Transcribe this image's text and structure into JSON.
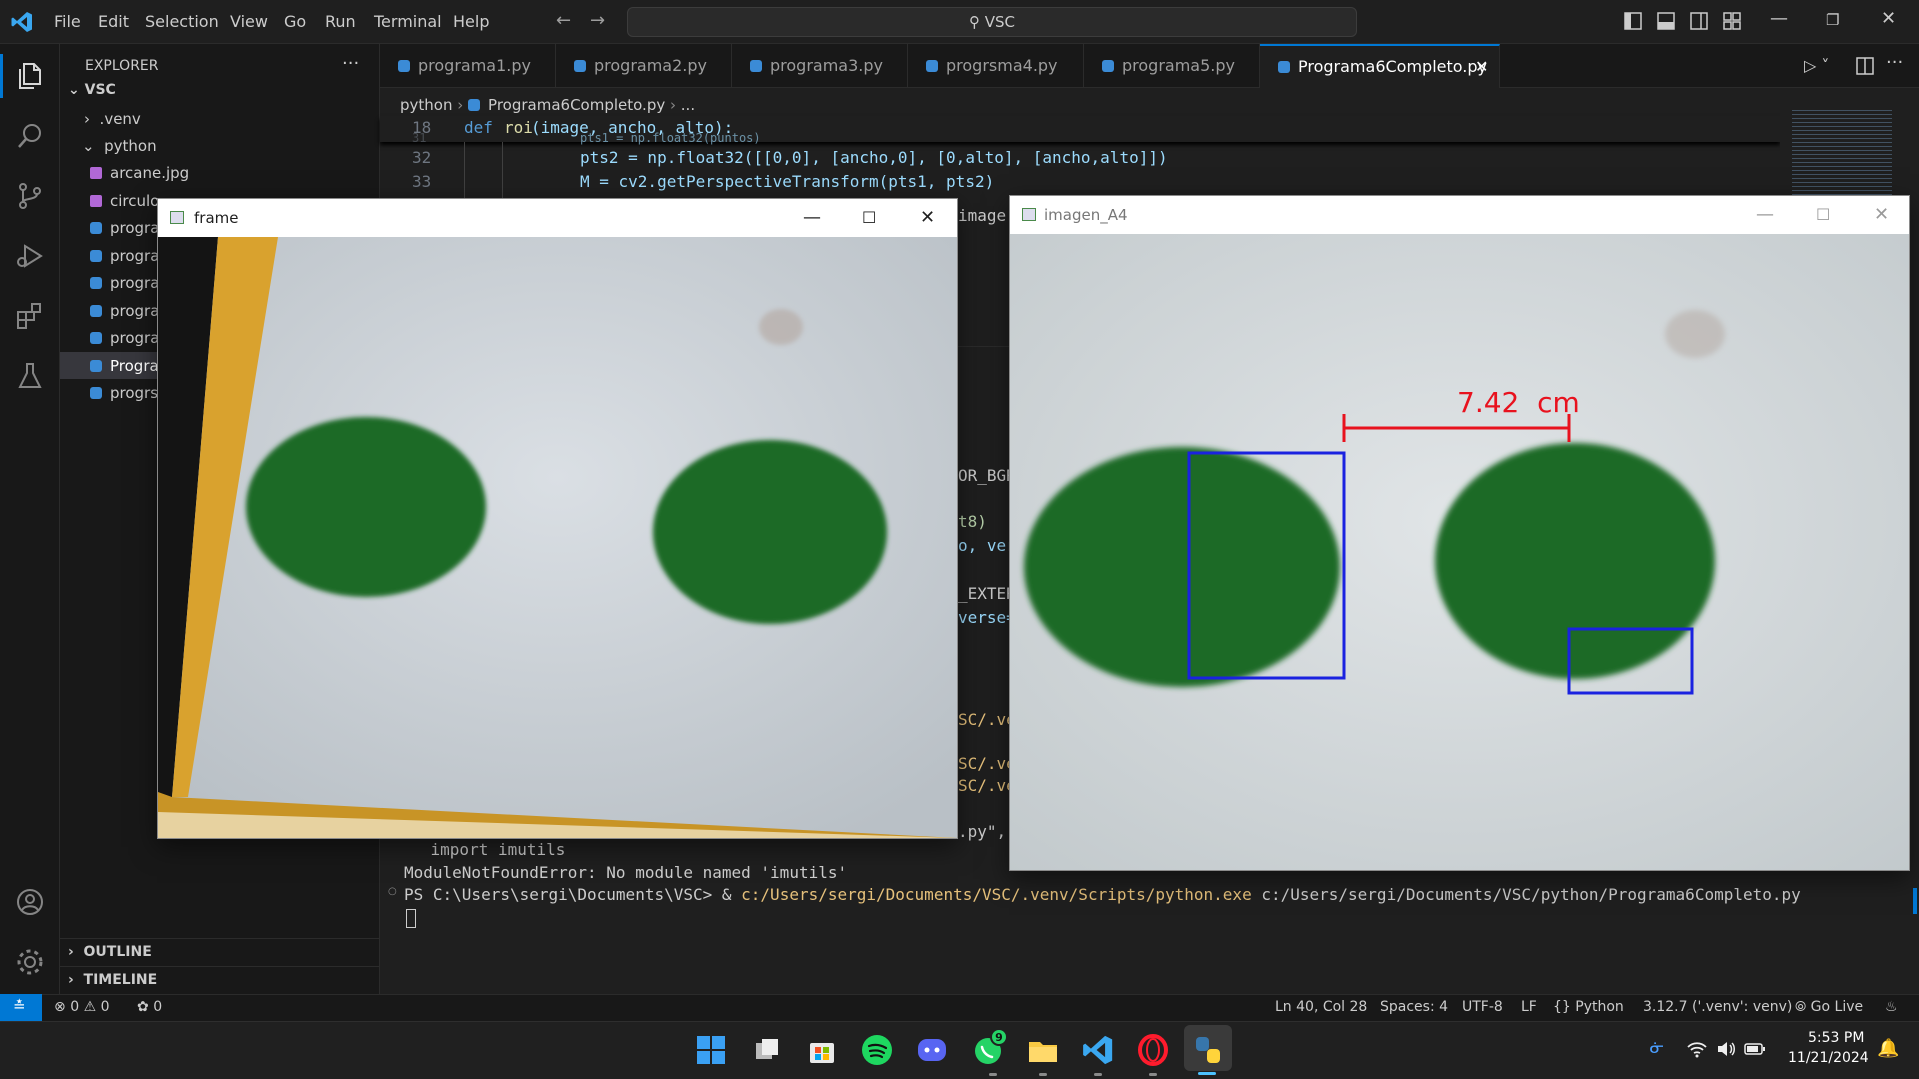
{
  "titlebar": {
    "menu": [
      "File",
      "Edit",
      "Selection",
      "View",
      "Go",
      "Run",
      "Terminal",
      "Help"
    ],
    "search": "VSC"
  },
  "sidebar": {
    "header": "EXPLORER",
    "more": "···",
    "root": "VSC",
    "items": [
      {
        "label": ".venv",
        "type": "folder"
      },
      {
        "label": "python",
        "type": "folder-open"
      },
      {
        "label": "arcane.jpg",
        "type": "image"
      },
      {
        "label": "circulo",
        "type": "image"
      },
      {
        "label": "progra",
        "type": "py"
      },
      {
        "label": "progra",
        "type": "py"
      },
      {
        "label": "progra",
        "type": "py"
      },
      {
        "label": "progra",
        "type": "py"
      },
      {
        "label": "progra",
        "type": "py"
      },
      {
        "label": "Progra",
        "type": "py"
      },
      {
        "label": "progrs",
        "type": "py"
      }
    ],
    "outline": "OUTLINE",
    "timeline": "TIMELINE"
  },
  "tabs": [
    {
      "label": "programa1.py"
    },
    {
      "label": "programa2.py"
    },
    {
      "label": "programa3.py"
    },
    {
      "label": "progrsma4.py"
    },
    {
      "label": "programa5.py"
    },
    {
      "label": "Programa6Completo.py",
      "active": true
    }
  ],
  "breadcrumb": {
    "folder": "python",
    "file": "Programa6Completo.py",
    "more": "..."
  },
  "code": {
    "sticky": {
      "line": "18",
      "kw": "def",
      "fn": "roi",
      "args": "(image, ancho, alto):"
    },
    "lines": [
      {
        "n": "31",
        "text": "pts1 = np.float32(puntos)"
      },
      {
        "n": "32",
        "text": "pts2 = np.float32([[0,0], [ancho,0], [0,alto], [ancho,alto]])"
      },
      {
        "n": "33",
        "text": "M = cv2.getPerspectiveTransform(pts1, pts2)"
      }
    ],
    "fragments": [
      "image,",
      "OR_BGR",
      "t8)",
      "o, ver",
      "_EXTER",
      "verse=",
      "SC/.ve",
      "SC/.ve",
      "SC/.ve",
      ".py\","
    ]
  },
  "terminal": {
    "lines": [
      "    import imutils",
      "ModuleNotFoundError: No module named 'imutils'"
    ],
    "prompt": "PS C:\\Users\\sergi\\Documents\\VSC> & ",
    "exe": "c:/Users/sergi/Documents/VSC/.venv/Scripts/python.exe",
    "script": " c:/Users/sergi/Documents/VSC/python/Programa6Completo.py"
  },
  "windows": {
    "frame": {
      "title": "frame"
    },
    "imagen": {
      "title": "imagen_A4",
      "measurement": "7.42  cm"
    }
  },
  "statusbar": {
    "errors": "0",
    "warnings": "0",
    "ports": "0",
    "position": "Ln 40, Col 28",
    "spaces": "Spaces: 4",
    "encoding": "UTF-8",
    "eol": "LF",
    "language": "Python",
    "interpreter": "3.12.7 ('.venv': venv)",
    "golive": "Go Live"
  },
  "taskbar": {
    "time": "5:53 PM",
    "date": "11/21/2024",
    "whatsapp_badge": "9"
  },
  "colors": {
    "accent": "#0078d4",
    "green_circle": "#1e6a28",
    "measure_line": "#e8121e",
    "box_blue": "#1a22e0"
  }
}
